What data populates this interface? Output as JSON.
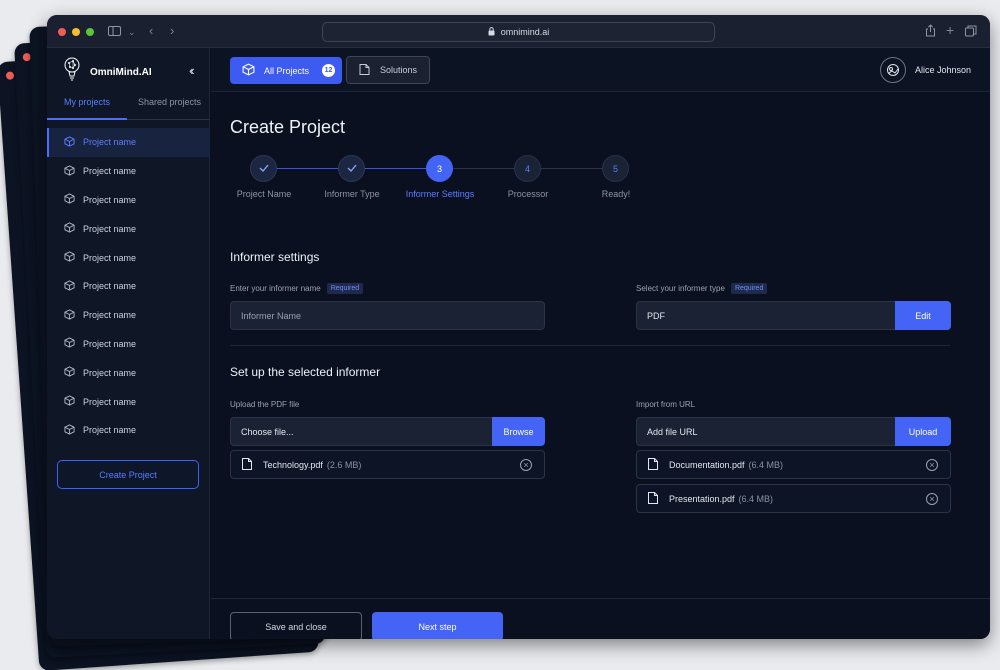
{
  "browser": {
    "url": "omnimind.ai"
  },
  "sidebar": {
    "brand": "OmniMind.AI",
    "tabs": [
      {
        "label": "My projects",
        "active": true
      },
      {
        "label": "Shared projects",
        "active": false
      }
    ],
    "projects": [
      {
        "label": "Project name",
        "active": true
      },
      {
        "label": "Project name",
        "active": false
      },
      {
        "label": "Project name",
        "active": false
      },
      {
        "label": "Project name",
        "active": false
      },
      {
        "label": "Project name",
        "active": false
      },
      {
        "label": "Project name",
        "active": false
      },
      {
        "label": "Project name",
        "active": false
      },
      {
        "label": "Project name",
        "active": false
      },
      {
        "label": "Project name",
        "active": false
      },
      {
        "label": "Project name",
        "active": false
      },
      {
        "label": "Project name",
        "active": false
      }
    ],
    "create_button": "Create Project"
  },
  "topbar": {
    "all_projects_label": "All Projects",
    "all_projects_count": "12",
    "solutions_label": "Solutions",
    "user_name": "Alice Johnson"
  },
  "main": {
    "title": "Create Project",
    "steps": [
      {
        "number": "1",
        "label": "Project Name",
        "status": "done"
      },
      {
        "number": "2",
        "label": "Informer Type",
        "status": "done"
      },
      {
        "number": "3",
        "label": "Informer Settings",
        "status": "current"
      },
      {
        "number": "4",
        "label": "Processor",
        "status": "todo"
      },
      {
        "number": "5",
        "label": "Ready!",
        "status": "todo"
      }
    ],
    "informer_settings": {
      "title": "Informer settings",
      "name_label": "Enter your informer name",
      "name_required": "Required",
      "name_placeholder": "Informer Name",
      "type_label": "Select your informer type",
      "type_required": "Required",
      "type_value": "PDF",
      "type_edit": "Edit"
    },
    "setup": {
      "title": "Set up the selected informer",
      "upload_label": "Upload the PDF file",
      "upload_placeholder": "Choose file...",
      "browse_label": "Browse",
      "uploaded_files": [
        {
          "name": "Technology.pdf",
          "size": "(2.6 MB)"
        }
      ],
      "url_label": "Import from URL",
      "url_placeholder": "Add file URL",
      "upload_button": "Upload",
      "url_files": [
        {
          "name": "Documentation.pdf",
          "size": "(6.4 MB)"
        },
        {
          "name": "Presentation.pdf",
          "size": "(6.4 MB)"
        }
      ]
    },
    "footer": {
      "save_label": "Save and close",
      "next_label": "Next step"
    }
  },
  "colors": {
    "accent": "#4364f5",
    "background": "#0a1020",
    "sidebar": "#0f1727",
    "traffic_red": "#ee5e56",
    "traffic_yellow": "#f5bf2f",
    "traffic_green": "#5ec43f"
  },
  "icons": {
    "project": "cube-icon",
    "file": "file-icon",
    "remove": "close-circle-icon",
    "check": "check-icon"
  }
}
